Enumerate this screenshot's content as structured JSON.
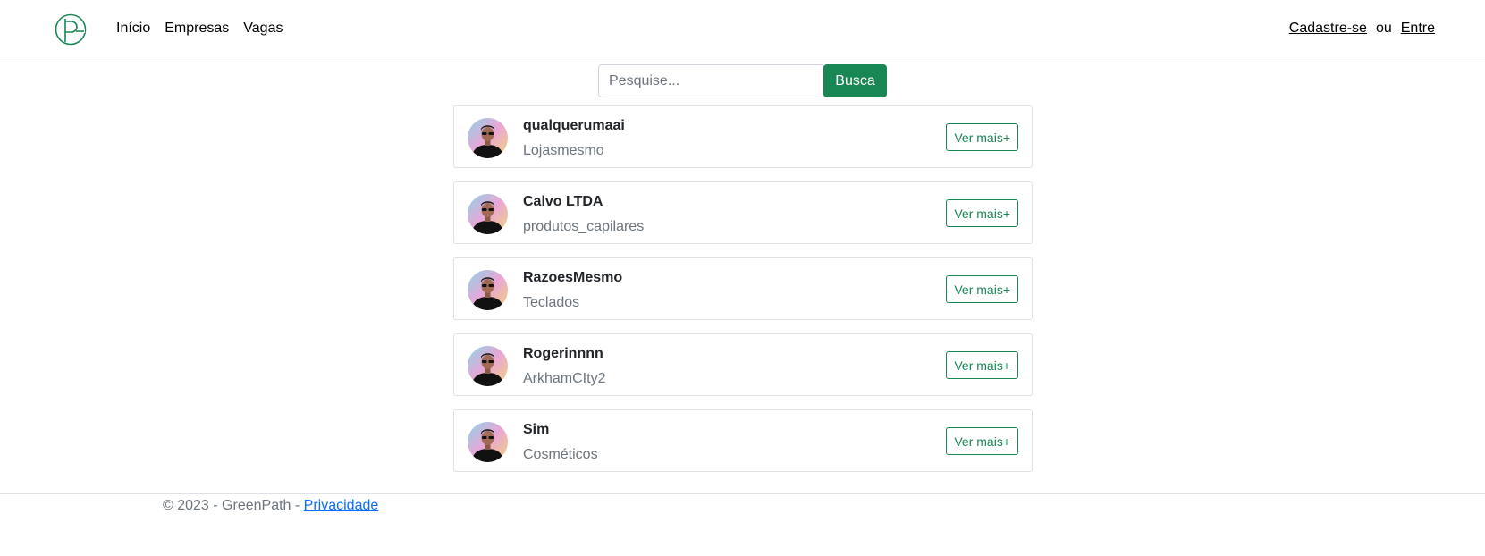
{
  "nav": {
    "links": [
      "Início",
      "Empresas",
      "Vagas"
    ],
    "signup_label": "Cadastre-se",
    "or_label": "ou",
    "login_label": "Entre"
  },
  "search": {
    "placeholder": "Pesquise...",
    "value": "",
    "button_label": "Busca"
  },
  "companies": [
    {
      "name": "qualquerumaai",
      "category": "Lojasmesmo",
      "button_label": "Ver mais+"
    },
    {
      "name": "Calvo LTDA",
      "category": "produtos_capilares",
      "button_label": "Ver mais+"
    },
    {
      "name": "RazoesMesmo",
      "category": "Teclados",
      "button_label": "Ver mais+"
    },
    {
      "name": "Rogerinnnn",
      "category": "ArkhamCIty2",
      "button_label": "Ver mais+"
    },
    {
      "name": "Sim",
      "category": "Cosméticos",
      "button_label": "Ver mais+"
    }
  ],
  "footer": {
    "copyright": "© 2023 - GreenPath - ",
    "privacy_label": "Privacidade"
  },
  "colors": {
    "primary": "#198754",
    "link": "#0d6efd",
    "muted": "#6c757d",
    "border": "#dee2e6"
  }
}
